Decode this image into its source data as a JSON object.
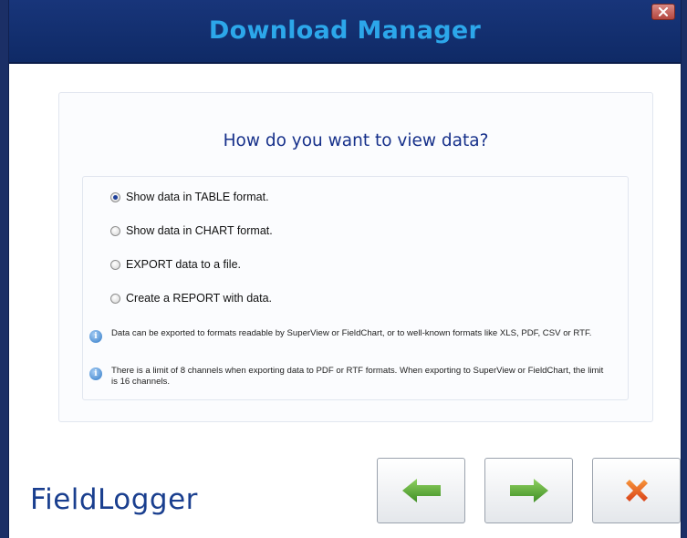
{
  "window": {
    "title": "Download Manager"
  },
  "panel": {
    "question": "How do you want to view data?",
    "options": [
      {
        "label": "Show data in TABLE format.",
        "selected": true
      },
      {
        "label": "Show data in CHART format.",
        "selected": false
      },
      {
        "label": "EXPORT data to a file.",
        "selected": false
      },
      {
        "label": "Create a REPORT with data.",
        "selected": false
      }
    ],
    "info": [
      "Data can be exported to formats readable by SuperView or FieldChart, or to well-known formats like XLS, PDF, CSV or RTF.",
      "There is a limit of 8 channels when exporting data to PDF or RTF formats. When exporting to SuperView or FieldChart, the limit is 16 channels."
    ]
  },
  "footer": {
    "logo": "FieldLogger",
    "buttons": [
      {
        "icon": "arrow-left-icon",
        "color": "#5aa83a"
      },
      {
        "icon": "arrow-right-icon",
        "color": "#5aa83a"
      },
      {
        "icon": "close-x-icon",
        "color": "#e2501b"
      }
    ]
  },
  "colors": {
    "titlebar": "#0f2a66",
    "title_text": "#2ca7ea",
    "question_text": "#16308a",
    "logo_text": "#1a3f8f"
  }
}
